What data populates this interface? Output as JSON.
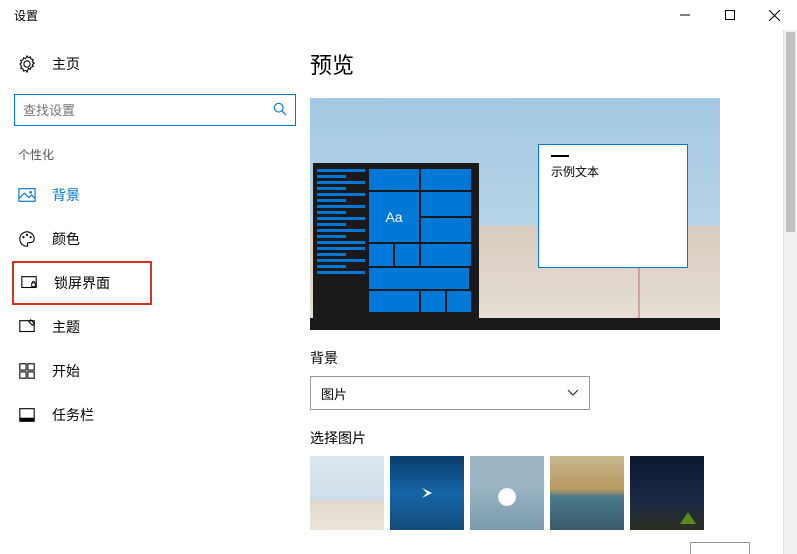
{
  "window": {
    "title": "设置",
    "controls": {
      "minimize": "minimize",
      "maximize": "maximize",
      "close": "close"
    }
  },
  "sidebar": {
    "home_label": "主页",
    "search_placeholder": "查找设置",
    "category": "个性化",
    "items": [
      {
        "icon": "image-icon",
        "label": "背景",
        "selected": true
      },
      {
        "icon": "palette-icon",
        "label": "颜色"
      },
      {
        "icon": "lockscreen-icon",
        "label": "锁屏界面",
        "highlighted": true
      },
      {
        "icon": "theme-icon",
        "label": "主题"
      },
      {
        "icon": "start-icon",
        "label": "开始"
      },
      {
        "icon": "taskbar-icon",
        "label": "任务栏"
      }
    ]
  },
  "main": {
    "heading": "预览",
    "preview": {
      "sample_text": "示例文本",
      "tile_label": "Aa"
    },
    "background_section_label": "背景",
    "background_dropdown_value": "图片",
    "choose_picture_label": "选择图片"
  }
}
